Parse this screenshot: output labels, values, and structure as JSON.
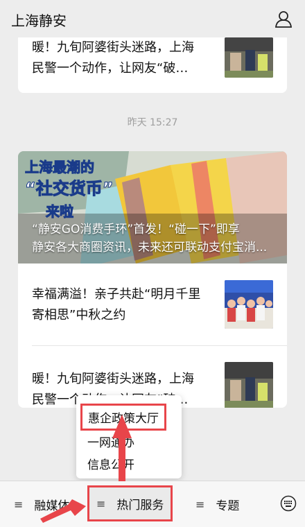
{
  "header": {
    "title": "上海静安",
    "user_icon": "user-icon"
  },
  "feed": {
    "top_article": {
      "title": "暖！九旬阿婆街头迷路，上海民警一个动作，让网友“破防”！"
    },
    "timestamp": "昨天 15:27",
    "hero": {
      "caption_line1": "“静安GO消费手环”首发！“碰一下”即享",
      "caption_line2": "静安各大商圈资讯，未来还可联动支付宝消..."
    },
    "articles": [
      {
        "title": "幸福满溢！亲子共赴“明月千里寄相思”中秋之约"
      },
      {
        "title": "暖！九旬阿婆街头迷路，上海民警一个动作，让网友“破防”！"
      }
    ]
  },
  "popup_menu": {
    "items": [
      "惠企政策大厅",
      "一网通办",
      "信息公开"
    ],
    "highlight_color": "#e8454a"
  },
  "tabbar": {
    "tabs": [
      {
        "label": "融媒体",
        "icon": "menu-icon"
      },
      {
        "label": "热门服务",
        "icon": "menu-icon"
      },
      {
        "label": "专题",
        "icon": "menu-icon"
      }
    ],
    "keyboard_icon": "keyboard-icon"
  }
}
